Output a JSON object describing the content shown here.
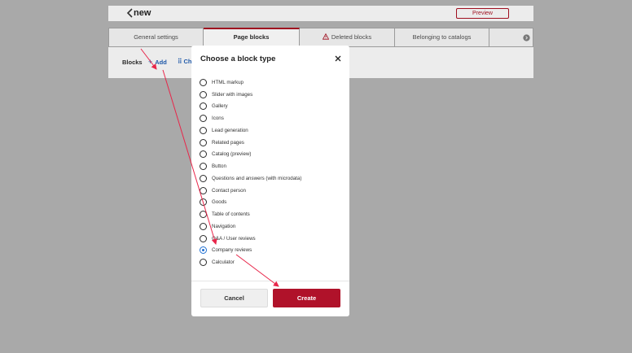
{
  "page": {
    "title": "new",
    "preview_label": "Preview"
  },
  "tabs": [
    {
      "label": "General settings"
    },
    {
      "label": "Page blocks"
    },
    {
      "label": "Deleted blocks"
    },
    {
      "label": "Belonging to catalogs"
    },
    {
      "label": ""
    }
  ],
  "blocks_bar": {
    "label": "Blocks",
    "add_label": "Add",
    "reorder_label": "Ch"
  },
  "modal": {
    "title": "Choose a block type",
    "options": [
      {
        "label": "HTML markup",
        "selected": false
      },
      {
        "label": "Slider with images",
        "selected": false
      },
      {
        "label": "Gallery",
        "selected": false
      },
      {
        "label": "Icons",
        "selected": false
      },
      {
        "label": "Lead generation",
        "selected": false
      },
      {
        "label": "Related pages",
        "selected": false
      },
      {
        "label": "Catalog (preview)",
        "selected": false
      },
      {
        "label": "Button",
        "selected": false
      },
      {
        "label": "Questions and answers (with microdata)",
        "selected": false
      },
      {
        "label": "Contact person",
        "selected": false
      },
      {
        "label": "Goods",
        "selected": false
      },
      {
        "label": "Table of contents",
        "selected": false
      },
      {
        "label": "Navigation",
        "selected": false
      },
      {
        "label": "Q&A / User reviews",
        "selected": false
      },
      {
        "label": "Company reviews",
        "selected": true
      },
      {
        "label": "Calculator",
        "selected": false
      }
    ],
    "cancel_label": "Cancel",
    "create_label": "Create"
  },
  "colors": {
    "accent": "#b0122a",
    "link": "#1d57a8",
    "radio_selected": "#1f6fd1",
    "annotation": "#e8264a",
    "overlay": "#a9a9a9"
  }
}
